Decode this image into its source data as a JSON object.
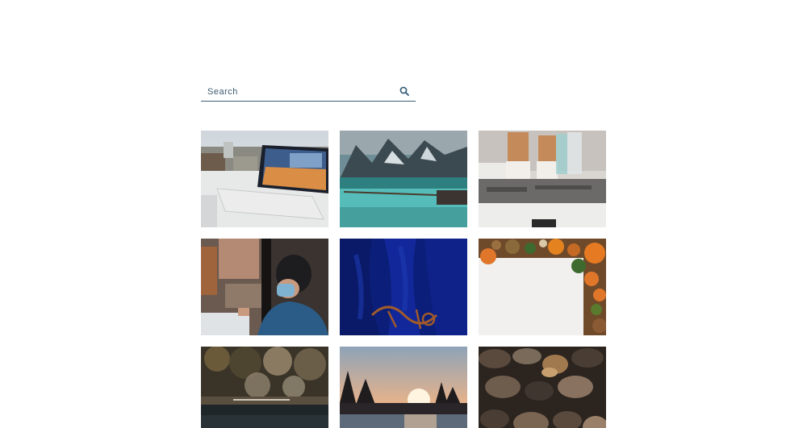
{
  "search": {
    "placeholder": "Search",
    "value": "",
    "icon": "search-icon"
  },
  "gallery": {
    "items": [
      {
        "name": "laptop-on-desk-photo"
      },
      {
        "name": "mountain-lake-photo"
      },
      {
        "name": "coffee-cups-counter-photo"
      },
      {
        "name": "person-with-mask-phone-photo"
      },
      {
        "name": "blue-fabric-photo"
      },
      {
        "name": "pumpkins-border-photo"
      },
      {
        "name": "forest-pond-photo"
      },
      {
        "name": "sunset-over-water-photo"
      },
      {
        "name": "dried-leaves-photo"
      }
    ]
  },
  "colors": {
    "accent": "#2f5a74",
    "underline": "#3b5d74"
  }
}
